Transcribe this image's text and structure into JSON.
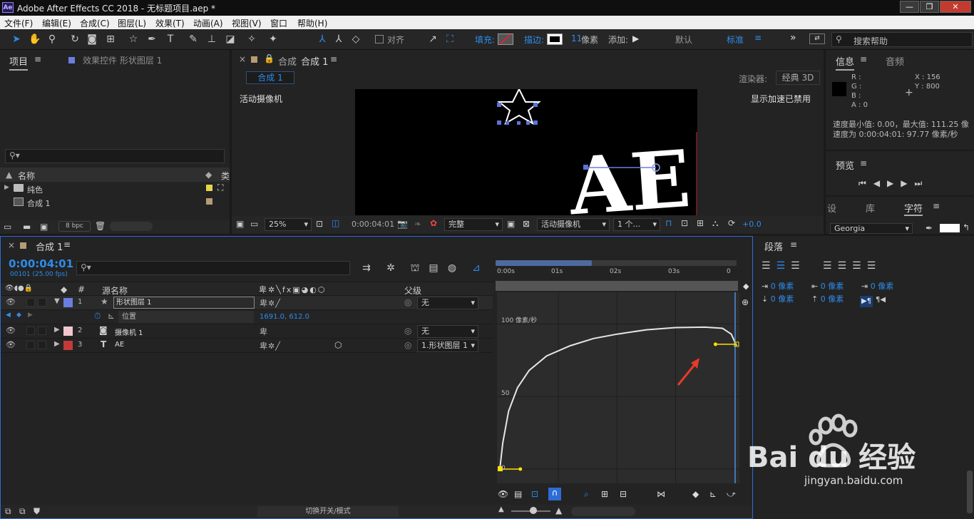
{
  "window": {
    "app_badge": "Ae",
    "title": "Adobe After Effects CC 2018 - 无标题项目.aep *",
    "controls": [
      "—",
      "❐",
      "✕"
    ]
  },
  "menu": [
    "文件(F)",
    "编辑(E)",
    "合成(C)",
    "图层(L)",
    "效果(T)",
    "动画(A)",
    "视图(V)",
    "窗口",
    "帮助(H)"
  ],
  "toolbar": {
    "snap_label": "对齐",
    "fill_label": "填充:",
    "stroke_label": "描边:",
    "stroke_width": "11",
    "stroke_unit": "像素",
    "add_label": "添加:",
    "workspace_default": "默认",
    "workspace_standard": "标准",
    "search_placeholder": "搜索帮助",
    "overflow": "»"
  },
  "project_panel": {
    "tab_project": "项目",
    "tab_effects": "效果控件 形状图层 1",
    "column_name": "名称",
    "column_type_abbr": "类",
    "items": [
      {
        "name": "纯色",
        "kind": "folder",
        "color": "#e6d44a"
      },
      {
        "name": "合成 1",
        "kind": "comp",
        "color": "#b59b77"
      }
    ],
    "bpc": "8 bpc"
  },
  "viewer": {
    "tab_close": "×",
    "tab_prefix": "合成",
    "tab_name": "合成 1",
    "comp_pill": "合成 1",
    "renderer_label": "渲染器:",
    "renderer_value": "经典 3D",
    "active_camera": "活动摄像机",
    "gpu_notice": "显示加速已禁用",
    "zoom": "25%",
    "timecode": "0:00:04:01",
    "resolution": "完整",
    "camera_select": "活动摄像机",
    "views": "1 个...",
    "exposure": "+0.0",
    "canvas_text": "AE"
  },
  "info_panel": {
    "tab_info": "信息",
    "tab_audio": "音频",
    "r": "R :",
    "g": "G :",
    "b": "B :",
    "a": "A : 0",
    "x": "X : 156",
    "y": "Y : 800",
    "speed_line1": "速度最小值: 0.00，最大值: 111.25 像",
    "speed_line2": "速度为 0:00:04:01:  97.77 像素/秒",
    "preview_tab": "预览",
    "tabs_row": [
      "设",
      "库",
      "字符"
    ],
    "font": "Georgia"
  },
  "timeline": {
    "comp_tab": "合成 1",
    "timecode": "0:00:04:01",
    "frames": "00101 (25.00 fps)",
    "search_placeholder": "",
    "col_source": "源名称",
    "col_parent": "父级",
    "col_hash": "#",
    "layers": [
      {
        "num": "1",
        "name": "形状图层 1",
        "color": "#6b7ee0",
        "parent": "无",
        "expanded": true
      },
      {
        "num": "2",
        "name": "摄像机 1",
        "color": "#f2c6cf",
        "parent": "无",
        "expanded": false
      },
      {
        "num": "3",
        "name": "AE",
        "color": "#c43a3a",
        "parent": "1.形状图层 1",
        "expanded": false
      }
    ],
    "prop_name": "位置",
    "prop_value": "1691.0, 612.0",
    "ruler": [
      "0:00s",
      "01s",
      "02s",
      "03s",
      "0"
    ],
    "graph_unit": "100 像素/秒",
    "graph_label_50": "50",
    "graph_label_0": "0",
    "switch_mode": "切换开关/模式"
  },
  "graph_data": {
    "type": "line",
    "ylabel": "像素/秒",
    "ylim": [
      0,
      112
    ],
    "xlim": [
      0,
      4.04
    ],
    "points": [
      [
        0,
        0
      ],
      [
        0.05,
        18
      ],
      [
        0.15,
        40
      ],
      [
        0.3,
        56
      ],
      [
        0.5,
        68
      ],
      [
        0.8,
        78
      ],
      [
        1.2,
        85
      ],
      [
        1.6,
        90
      ],
      [
        2.0,
        93
      ],
      [
        2.5,
        96
      ],
      [
        3.0,
        97.5
      ],
      [
        3.5,
        97.8
      ],
      [
        3.8,
        97
      ],
      [
        3.95,
        93
      ],
      [
        4.04,
        85
      ]
    ]
  },
  "paragraph_panel": {
    "title": "段落",
    "indent_values": [
      "0 像素",
      "0 像素",
      "0 像素",
      "0 像素",
      "0 像素"
    ]
  },
  "watermark": {
    "brand": "Bai du 经验",
    "url": "jingyan.baidu.com"
  }
}
